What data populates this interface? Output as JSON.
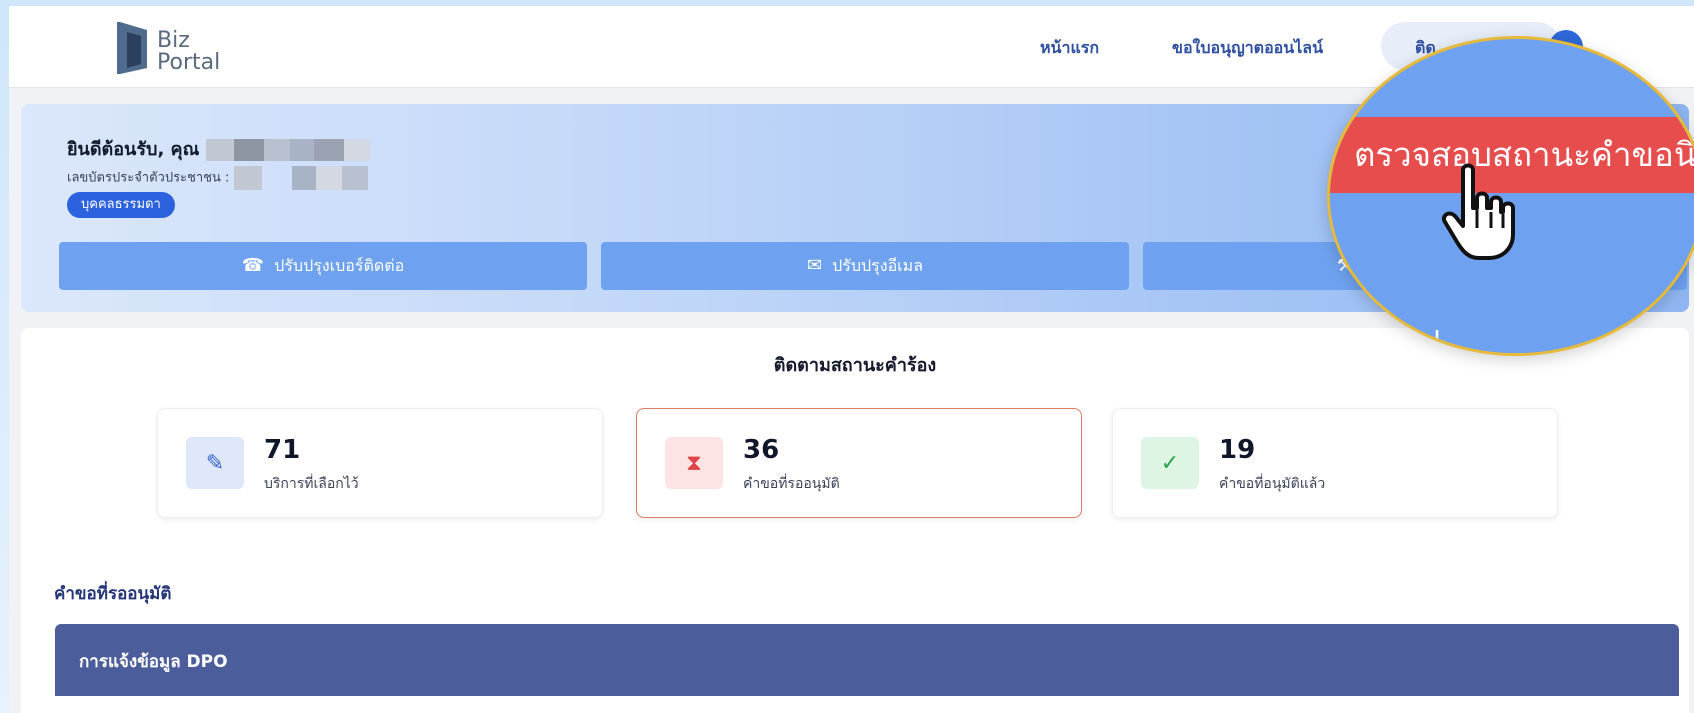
{
  "header": {
    "logo": {
      "line1": "Biz",
      "line2": "Portal"
    },
    "nav": {
      "home": "หน้าแรก",
      "license_online": "ขอใบอนุญาตออนไลน์",
      "pill_label": "ติด"
    }
  },
  "welcome": {
    "title": "ยินดีต้อนรับ, คุณ",
    "id_label": "เลขบัตรประจำตัวประชาชน :",
    "badge": "บุคคลธรรมดา",
    "buttons": {
      "phone": "ปรับปรุงเบอร์ติดต่อ",
      "email": "ปรับปรุงอีเมล"
    }
  },
  "tracking": {
    "title": "ติดตามสถานะคำร้อง",
    "cards": [
      {
        "value": "71",
        "label": "บริการที่เลือกไว้",
        "icon": "pencil-icon"
      },
      {
        "value": "36",
        "label": "คำขอที่รออนุมัติ",
        "icon": "hourglass-icon"
      },
      {
        "value": "19",
        "label": "คำขอที่อนุมัติแล้ว",
        "icon": "check-icon"
      }
    ],
    "section_label": "คำขอที่รออนุมัติ",
    "dpo_title": "การแจ้งข้อมูล DPO"
  },
  "magnifier": {
    "highlight_text": "ตรวจสอบสถานะคำขอนิติ",
    "lower_text": "ol"
  },
  "colors": {
    "primary": "#2c62dd",
    "button": "#6ea2f0",
    "highlight": "#e84d4d",
    "dpo_bar": "#4b5d9a",
    "magnifier_ring": "#e5b93a"
  }
}
